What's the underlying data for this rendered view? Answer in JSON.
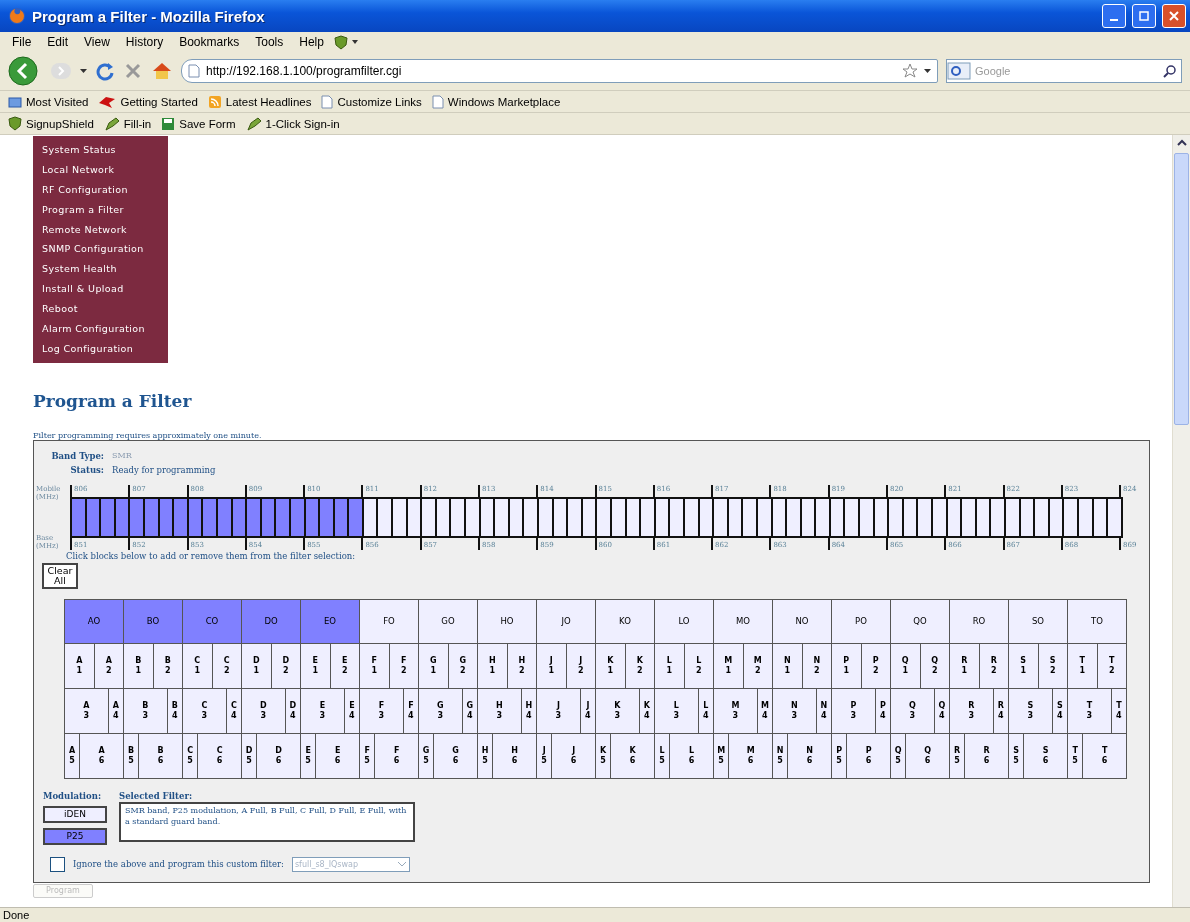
{
  "window": {
    "title": "Program a Filter - Mozilla Firefox"
  },
  "menu_bar": [
    "File",
    "Edit",
    "View",
    "History",
    "Bookmarks",
    "Tools",
    "Help"
  ],
  "address": {
    "url": "http://192.168.1.100/programfilter.cgi"
  },
  "search": {
    "placeholder": "Google"
  },
  "bookmarks": [
    {
      "label": "Most Visited",
      "kind": "folder"
    },
    {
      "label": "Getting Started",
      "kind": "bird"
    },
    {
      "label": "Latest Headlines",
      "kind": "feed"
    },
    {
      "label": "Customize Links",
      "kind": "page"
    },
    {
      "label": "Windows Marketplace",
      "kind": "page"
    }
  ],
  "addon_toolbar": [
    {
      "label": "SignupShield",
      "kind": "shield"
    },
    {
      "label": "Fill-in",
      "kind": "pen"
    },
    {
      "label": "Save Form",
      "kind": "disk"
    },
    {
      "label": "1-Click Sign-in",
      "kind": "pen"
    }
  ],
  "sidebar": {
    "items": [
      "System Status",
      "Local Network",
      "RF Configuration",
      "Program a Filter",
      "Remote Network",
      "SNMP Configuration",
      "System Health",
      "Install & Upload",
      "Reboot",
      "Alarm Configuration",
      "Log Configuration"
    ]
  },
  "page": {
    "heading": "Program a Filter",
    "note": "Filter programming requires approximately one minute."
  },
  "panel": {
    "band_type_label": "Band Type:",
    "band_type": "SMR",
    "status_label": "Status:",
    "status": "Ready for programming",
    "band": {
      "top_axis": "Mobile (MHz)",
      "bottom_axis": "Base (MHz)",
      "top_ticks": [
        "806",
        "807",
        "808",
        "809",
        "810",
        "811",
        "812",
        "813",
        "814",
        "815",
        "816",
        "817",
        "818",
        "819",
        "820",
        "821",
        "822",
        "823",
        "824"
      ],
      "bottom_ticks": [
        "851",
        "852",
        "853",
        "854",
        "855",
        "856",
        "857",
        "858",
        "859",
        "860",
        "861",
        "862",
        "863",
        "864",
        "865",
        "866",
        "867",
        "868",
        "869"
      ],
      "blocks": [
        {
          "selected": true
        },
        {
          "selected": true
        },
        {
          "selected": true
        },
        {
          "selected": true
        },
        {
          "selected": true
        },
        {
          "selected": true
        },
        {
          "selected": true
        },
        {
          "selected": true
        },
        {
          "selected": true
        },
        {
          "selected": true
        },
        {
          "selected": true
        },
        {
          "selected": true
        },
        {
          "selected": true
        },
        {
          "selected": true
        },
        {
          "selected": true
        },
        {
          "selected": true
        },
        {
          "selected": true
        },
        {
          "selected": true
        },
        {
          "selected": true
        },
        {
          "selected": true
        },
        {
          "selected": false
        },
        {
          "selected": false
        },
        {
          "selected": false
        },
        {
          "selected": false
        },
        {
          "selected": false
        },
        {
          "selected": false
        },
        {
          "selected": false
        },
        {
          "selected": false
        },
        {
          "selected": false
        },
        {
          "selected": false
        },
        {
          "selected": false
        },
        {
          "selected": false
        },
        {
          "selected": false
        },
        {
          "selected": false
        },
        {
          "selected": false
        },
        {
          "selected": false
        },
        {
          "selected": false
        },
        {
          "selected": false
        },
        {
          "selected": false
        },
        {
          "selected": false
        },
        {
          "selected": false
        },
        {
          "selected": false
        },
        {
          "selected": false
        },
        {
          "selected": false
        },
        {
          "selected": false
        },
        {
          "selected": false
        },
        {
          "selected": false
        },
        {
          "selected": false
        },
        {
          "selected": false
        },
        {
          "selected": false
        },
        {
          "selected": false
        },
        {
          "selected": false
        },
        {
          "selected": false
        },
        {
          "selected": false
        },
        {
          "selected": false
        },
        {
          "selected": false
        },
        {
          "selected": false
        },
        {
          "selected": false
        },
        {
          "selected": false
        },
        {
          "selected": false
        },
        {
          "selected": false
        },
        {
          "selected": false
        },
        {
          "selected": false
        },
        {
          "selected": false
        },
        {
          "selected": false
        },
        {
          "selected": false
        },
        {
          "selected": false
        },
        {
          "selected": false
        },
        {
          "selected": false
        },
        {
          "selected": false
        },
        {
          "selected": false
        },
        {
          "selected": false
        }
      ]
    },
    "instruction": "Click blocks below to add or remove them from the filter selection:",
    "clear_button": "Clear All",
    "groups": [
      {
        "header": "AO",
        "selected": true,
        "blocks": [
          "A 1",
          "A 2",
          "A 3",
          "A 4",
          "A 5",
          "A 6"
        ]
      },
      {
        "header": "BO",
        "selected": true,
        "blocks": [
          "B 1",
          "B 2",
          "B 3",
          "B 4",
          "B 5",
          "B 6"
        ]
      },
      {
        "header": "CO",
        "selected": true,
        "blocks": [
          "C 1",
          "C 2",
          "C 3",
          "C 4",
          "C 5",
          "C 6"
        ]
      },
      {
        "header": "DO",
        "selected": true,
        "blocks": [
          "D 1",
          "D 2",
          "D 3",
          "D 4",
          "D 5",
          "D 6"
        ]
      },
      {
        "header": "EO",
        "selected": true,
        "blocks": [
          "E 1",
          "E 2",
          "E 3",
          "E 4",
          "E 5",
          "E 6"
        ]
      },
      {
        "header": "FO",
        "selected": false,
        "blocks": [
          "F 1",
          "F 2",
          "F 3",
          "F 4",
          "F 5",
          "F 6"
        ]
      },
      {
        "header": "GO",
        "selected": false,
        "blocks": [
          "G 1",
          "G 2",
          "G 3",
          "G 4",
          "G 5",
          "G 6"
        ]
      },
      {
        "header": "HO",
        "selected": false,
        "blocks": [
          "H 1",
          "H 2",
          "H 3",
          "H 4",
          "H 5",
          "H 6"
        ]
      },
      {
        "header": "JO",
        "selected": false,
        "blocks": [
          "J 1",
          "J 2",
          "J 3",
          "J 4",
          "J 5",
          "J 6"
        ]
      },
      {
        "header": "KO",
        "selected": false,
        "blocks": [
          "K 1",
          "K 2",
          "K 3",
          "K 4",
          "K 5",
          "K 6"
        ]
      },
      {
        "header": "LO",
        "selected": false,
        "blocks": [
          "L 1",
          "L 2",
          "L 3",
          "L 4",
          "L 5",
          "L 6"
        ]
      },
      {
        "header": "MO",
        "selected": false,
        "blocks": [
          "M 1",
          "M 2",
          "M 3",
          "M 4",
          "M 5",
          "M 6"
        ]
      },
      {
        "header": "NO",
        "selected": false,
        "blocks": [
          "N 1",
          "N 2",
          "N 3",
          "N 4",
          "N 5",
          "N 6"
        ]
      },
      {
        "header": "PO",
        "selected": false,
        "blocks": [
          "P 1",
          "P 2",
          "P 3",
          "P 4",
          "P 5",
          "P 6"
        ]
      },
      {
        "header": "QO",
        "selected": false,
        "blocks": [
          "Q 1",
          "Q 2",
          "Q 3",
          "Q 4",
          "Q 5",
          "Q 6"
        ]
      },
      {
        "header": "RO",
        "selected": false,
        "blocks": [
          "R 1",
          "R 2",
          "R 3",
          "R 4",
          "R 5",
          "R 6"
        ]
      },
      {
        "header": "SO",
        "selected": false,
        "blocks": [
          "S 1",
          "S 2",
          "S 3",
          "S 4",
          "S 5",
          "S 6"
        ]
      },
      {
        "header": "TO",
        "selected": false,
        "blocks": [
          "T 1",
          "T 2",
          "T 3",
          "T 4",
          "T 5",
          "T 6"
        ]
      }
    ],
    "modulation": {
      "label": "Modulation:",
      "options": [
        {
          "label": "iDEN",
          "selected": false
        },
        {
          "label": "P25",
          "selected": true
        }
      ]
    },
    "selected_filter": {
      "label": "Selected Filter:",
      "text": "SMR band, P25 modulation, A Full, B Full, C Full, D Full, E Full, with a standard guard band."
    },
    "custom": {
      "checked": false,
      "label": "Ignore the above and program this custom filter:",
      "value": "sfull_s8_IQswap",
      "disabled": true
    }
  },
  "program_button": {
    "label": "Program",
    "disabled": true
  },
  "status_bar": "Done"
}
